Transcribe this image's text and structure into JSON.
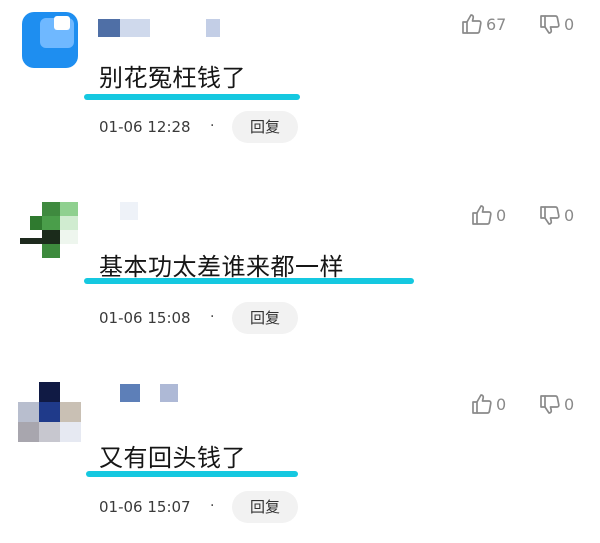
{
  "comments": [
    {
      "text": "别花冤枉钱了",
      "date": "01-06",
      "time": "12:28",
      "separator": "·",
      "reply_label": "回复",
      "like_count": "67",
      "dislike_count": "0"
    },
    {
      "text": "基本功太差谁来都一样",
      "date": "01-06",
      "time": "15:08",
      "separator": "·",
      "reply_label": "回复",
      "like_count": "0",
      "dislike_count": "0"
    },
    {
      "text": "又有回头钱了",
      "date": "01-06",
      "time": "15:07",
      "separator": "·",
      "reply_label": "回复",
      "like_count": "0",
      "dislike_count": "0"
    }
  ],
  "colors": {
    "highlight": "#15c8e0",
    "reply_bg": "#f2f2f2",
    "icon_gray": "#8a8a8a"
  },
  "icons": [
    "thumbs-up-icon",
    "thumbs-down-icon"
  ]
}
